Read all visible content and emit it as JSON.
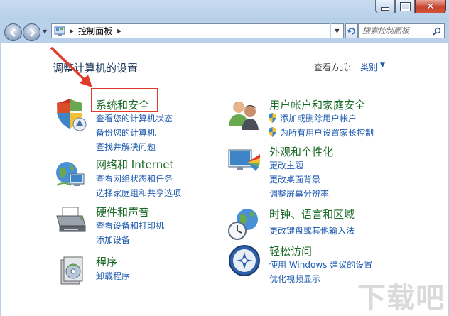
{
  "window": {
    "minimize_icon": "minimize-icon",
    "maximize_icon": "maximize-icon",
    "close_icon": "close-icon"
  },
  "address": {
    "crumb": "控制面板",
    "search_placeholder": "搜索控制面板"
  },
  "main": {
    "heading": "调整计算机的设置",
    "view_by_label": "查看方式:",
    "view_by_value": "类别"
  },
  "categories": [
    {
      "title": "系统和安全",
      "icon": "shield-icon",
      "links": [
        "查看您的计算机状态",
        "备份您的计算机",
        "查找并解决问题"
      ]
    },
    {
      "title": "网络和 Internet",
      "icon": "network-icon",
      "links": [
        "查看网络状态和任务",
        "选择家庭组和共享选项"
      ]
    },
    {
      "title": "硬件和声音",
      "icon": "printer-icon",
      "links": [
        "查看设备和打印机",
        "添加设备"
      ]
    },
    {
      "title": "程序",
      "icon": "programs-icon",
      "links": [
        "卸载程序"
      ]
    },
    {
      "title": "用户帐户和家庭安全",
      "icon": "users-icon",
      "links": [
        "添加或删除用户帐户",
        "为所有用户设置家长控制"
      ]
    },
    {
      "title": "外观和个性化",
      "icon": "appearance-icon",
      "links": [
        "更改主题",
        "更改桌面背景",
        "调整屏幕分辨率"
      ]
    },
    {
      "title": "时钟、语言和区域",
      "icon": "clock-globe-icon",
      "links": [
        "更改键盘或其他输入法"
      ]
    },
    {
      "title": "轻松访问",
      "icon": "accessibility-icon",
      "links": [
        "使用 Windows 建议的设置",
        "优化视频显示"
      ]
    }
  ],
  "watermark": "下载吧",
  "colors": {
    "category_title": "#1a6a27",
    "link": "#1e5aaf",
    "annotation": "#e03b2c"
  }
}
